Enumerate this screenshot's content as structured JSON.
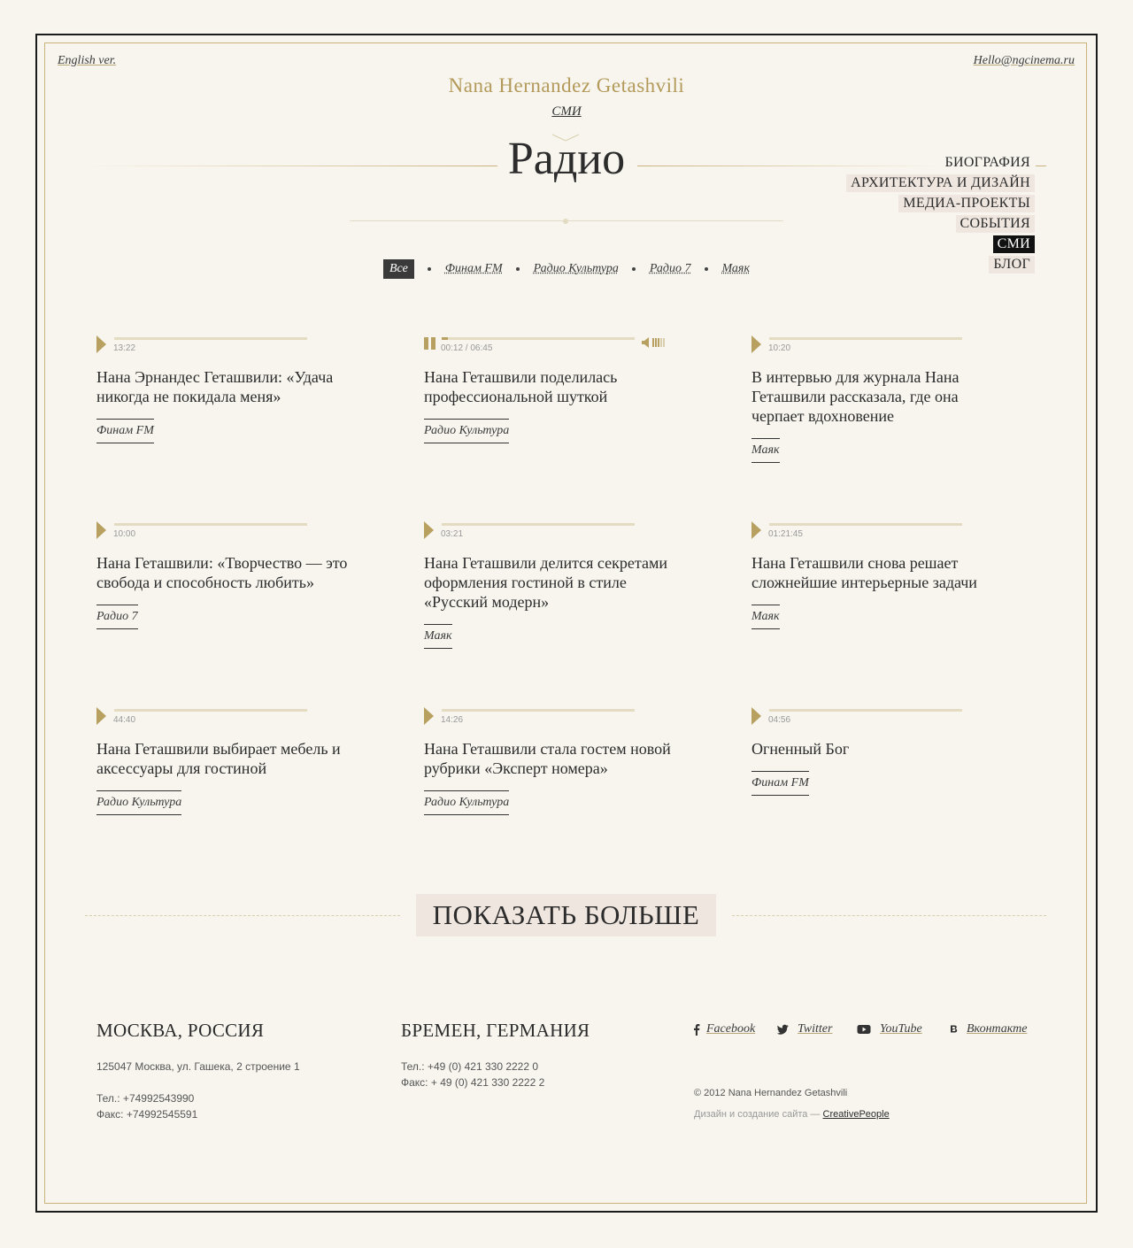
{
  "header": {
    "lang_link": "English ver.",
    "email": "Hello@ngcinema.ru",
    "brand": "Nana Hernandez Getashvili",
    "section": "СМИ",
    "page_title": "Радио"
  },
  "nav": {
    "items": [
      {
        "label": "БИОГРАФИЯ"
      },
      {
        "label": "АРХИТЕКТУРА И ДИЗАЙН"
      },
      {
        "label": "МЕДИА-ПРОЕКТЫ"
      },
      {
        "label": "СОБЫТИЯ"
      },
      {
        "label": "СМИ"
      },
      {
        "label": "БЛОГ"
      }
    ],
    "active": "СМИ"
  },
  "filters": {
    "items": [
      {
        "label": "Все"
      },
      {
        "label": "Финам FM"
      },
      {
        "label": "Радио Культура"
      },
      {
        "label": "Радио 7"
      },
      {
        "label": "Маяк"
      }
    ],
    "active": "Все"
  },
  "cards": [
    {
      "time": "13:22",
      "title": "Нана Эрнандес Геташвили: «Удача никогда не покидала меня»",
      "tag": "Финам FM",
      "progress": 0
    },
    {
      "time": "00:12 / 06:45",
      "title": "Нана Геташвили поделилась профессиональной шуткой",
      "tag": "Радио Культура",
      "progress": 0.03,
      "playing": true
    },
    {
      "time": "10:20",
      "title": "В интервью для журнала Нана Геташвили рассказала, где она черпает вдохновение",
      "tag": "Маяк",
      "progress": 0
    },
    {
      "time": "10:00",
      "title": "Нана Геташвили: «Творчество — это свобода и способность любить»",
      "tag": "Радио 7",
      "progress": 0
    },
    {
      "time": "03:21",
      "title": "Нана Геташвили делится секретами оформления гостиной в стиле «Русский модерн»",
      "tag": "Маяк",
      "progress": 0
    },
    {
      "time": "01:21:45",
      "title": "Нана Геташвили снова решает сложнейшие интерьерные задачи",
      "tag": "Маяк",
      "progress": 0
    },
    {
      "time": "44:40",
      "title": "Нана Геташвили выбирает мебель и аксессуары для гостиной",
      "tag": "Радио Культура",
      "progress": 0
    },
    {
      "time": "14:26",
      "title": "Нана Геташвили стала гостем новой рубрики «Эксперт номера»",
      "tag": "Радио Культура",
      "progress": 0
    },
    {
      "time": "04:56",
      "title": "Огненный Бог",
      "tag": "Финам FM",
      "progress": 0
    }
  ],
  "show_more": "ПОКАЗАТЬ БОЛЬШЕ",
  "footer": {
    "moscow": {
      "city": "МОСКВА, РОССИЯ",
      "address": "125047 Москва, ул. Гашека, 2 строение 1",
      "phone": "Тел.: +74992543990",
      "fax": "Факс: +74992545591"
    },
    "bremen": {
      "city": "БРЕМЕН, ГЕРМАНИЯ",
      "phone": "Тел.: +49 (0) 421 330 2222 0",
      "fax": "Факс: + 49 (0) 421 330 2222 2"
    },
    "social": [
      {
        "label": "Facebook",
        "icon": "facebook-icon"
      },
      {
        "label": "Twitter",
        "icon": "twitter-icon"
      },
      {
        "label": "YouTube",
        "icon": "youtube-icon"
      },
      {
        "label": "Вконтакте",
        "icon": "vkontakte-icon"
      }
    ],
    "copyright": "© 2012 Nana Hernandez Getashvili",
    "credit_prefix": "Дизайн и создание сайта —",
    "credit_link": "CreativePeople"
  },
  "colors": {
    "accent_gold": "#b8a060",
    "nav_bg": "#efe6df",
    "page_bg": "#f7f5ee"
  }
}
